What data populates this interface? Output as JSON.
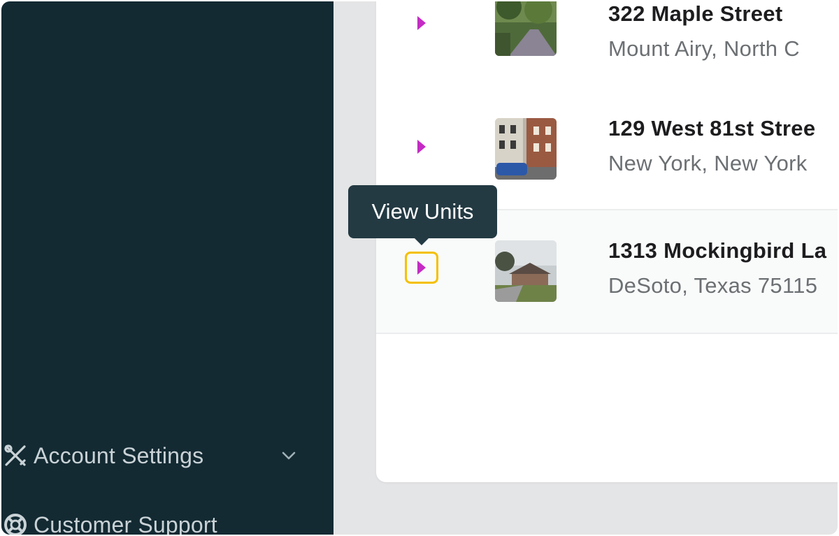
{
  "sidebar": {
    "items": [
      {
        "label": "Account Settings",
        "icon": "tools-icon",
        "has_chevron": true
      },
      {
        "label": "Customer Support",
        "icon": "lifebuoy-icon"
      }
    ]
  },
  "properties": [
    {
      "street": "322 Maple Street",
      "city": "Mount Airy, North C",
      "thumb": "tree-lined-street-photo"
    },
    {
      "street": "129 West 81st Stree",
      "city": "New York, New York",
      "thumb": "brownstone-building-photo"
    },
    {
      "street": "1313 Mockingbird La",
      "city": "DeSoto, Texas 75115",
      "thumb": "suburban-house-photo"
    }
  ],
  "tooltip": {
    "text": "View Units"
  },
  "colors": {
    "sidebar_bg": "#132a33",
    "accent_triangle": "#c42bc4",
    "focus_ring": "#f5c000",
    "tooltip_bg": "#233a43",
    "page_bg": "#e4e5e6"
  }
}
